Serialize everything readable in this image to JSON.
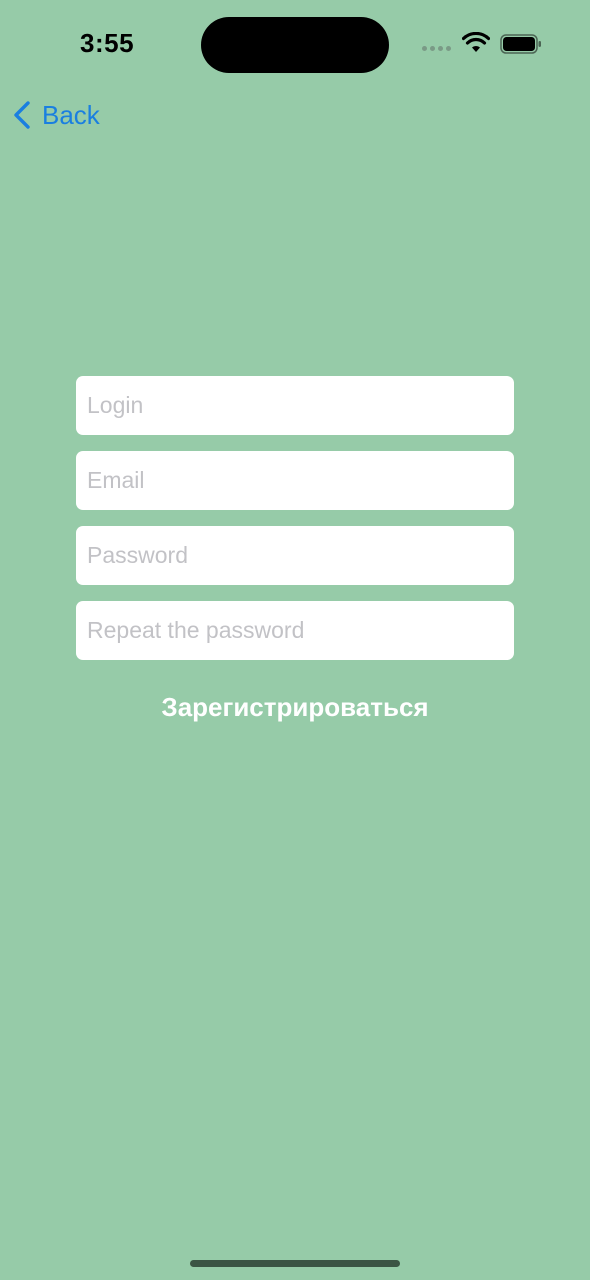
{
  "status_bar": {
    "time": "3:55",
    "wifi_icon": "wifi-icon",
    "battery_icon": "battery-icon",
    "signal_icon": "cellular-dots-icon"
  },
  "nav": {
    "back_label": "Back",
    "back_icon": "chevron-left-icon"
  },
  "form": {
    "login_placeholder": "Login",
    "email_placeholder": "Email",
    "password_placeholder": "Password",
    "repeat_password_placeholder": "Repeat the password",
    "login_value": "",
    "email_value": "",
    "password_value": "",
    "repeat_password_value": ""
  },
  "register_button_label": "Зарегистрироваться",
  "colors": {
    "background": "#96cba8",
    "accent": "#1a7fe0",
    "field_background": "#ffffff",
    "placeholder": "#c2c2c6",
    "button_text": "#ffffff"
  }
}
